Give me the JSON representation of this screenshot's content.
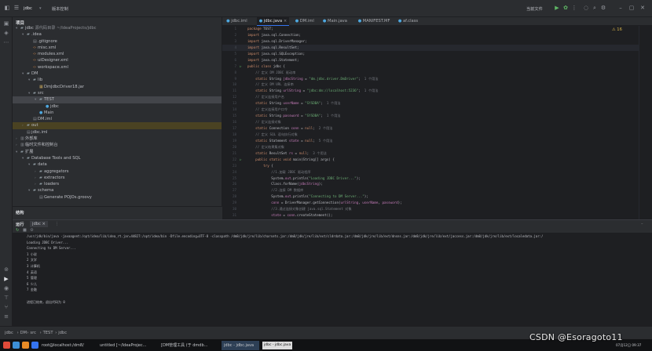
{
  "titlebar": {
    "project": "jdbc",
    "vcs": "版本控制",
    "run_config": "当前文件",
    "menu_icon": "hamburger-icon"
  },
  "project_panel": {
    "header": "项目",
    "tree": [
      {
        "depth": 0,
        "arrow": "▾",
        "icon": "folder",
        "label": "jdbc",
        "extra": " 源代码目录 ~/IdeaProjects/jdbc"
      },
      {
        "depth": 1,
        "arrow": "▾",
        "icon": "folder",
        "label": ".idea",
        "extra": ""
      },
      {
        "depth": 2,
        "arrow": "",
        "icon": "file",
        "label": ".gitignore",
        "extra": ""
      },
      {
        "depth": 2,
        "arrow": "",
        "icon": "xml",
        "label": "misc.xml",
        "extra": ""
      },
      {
        "depth": 2,
        "arrow": "",
        "icon": "xml",
        "label": "modules.xml",
        "extra": ""
      },
      {
        "depth": 2,
        "arrow": "",
        "icon": "xml",
        "label": "uiDesigner.xml",
        "extra": ""
      },
      {
        "depth": 2,
        "arrow": "",
        "icon": "xml",
        "label": "workspace.xml",
        "extra": ""
      },
      {
        "depth": 1,
        "arrow": "▾",
        "icon": "folder",
        "label": "DM",
        "extra": ""
      },
      {
        "depth": 2,
        "arrow": "▾",
        "icon": "folder",
        "label": "lib",
        "extra": ""
      },
      {
        "depth": 3,
        "arrow": "",
        "icon": "jar",
        "label": "DmJdbcDriver18.jar",
        "extra": ""
      },
      {
        "depth": 2,
        "arrow": "▾",
        "icon": "folder",
        "label": "src",
        "extra": ""
      },
      {
        "depth": 3,
        "arrow": "▾",
        "icon": "folder",
        "label": "TEST",
        "extra": "",
        "sel": true
      },
      {
        "depth": 4,
        "arrow": "",
        "icon": "java",
        "label": "jdbc",
        "extra": ""
      },
      {
        "depth": 3,
        "arrow": "",
        "icon": "java",
        "label": "Main",
        "extra": ""
      },
      {
        "depth": 2,
        "arrow": "",
        "icon": "file",
        "label": "DM.iml",
        "extra": ""
      },
      {
        "depth": 1,
        "arrow": "›",
        "icon": "folder",
        "label": "out",
        "extra": "",
        "hl": true
      },
      {
        "depth": 1,
        "arrow": "",
        "icon": "file",
        "label": "jdbc.iml",
        "extra": ""
      },
      {
        "depth": 0,
        "arrow": "›",
        "icon": "lib",
        "label": "外部库",
        "extra": ""
      },
      {
        "depth": 0,
        "arrow": "›",
        "icon": "lib",
        "label": "临时文件和控制台",
        "extra": ""
      },
      {
        "depth": 0,
        "arrow": "▾",
        "icon": "folder",
        "label": "扩展",
        "extra": ""
      },
      {
        "depth": 1,
        "arrow": "▾",
        "icon": "folder",
        "label": "Database Tools and SQL",
        "extra": ""
      },
      {
        "depth": 2,
        "arrow": "▾",
        "icon": "folder",
        "label": "data",
        "extra": ""
      },
      {
        "depth": 3,
        "arrow": "›",
        "icon": "folder",
        "label": "aggregators",
        "extra": ""
      },
      {
        "depth": 3,
        "arrow": "›",
        "icon": "folder",
        "label": "extractors",
        "extra": ""
      },
      {
        "depth": 3,
        "arrow": "›",
        "icon": "folder",
        "label": "loaders",
        "extra": ""
      },
      {
        "depth": 2,
        "arrow": "▾",
        "icon": "folder",
        "label": "schema",
        "extra": ""
      },
      {
        "depth": 3,
        "arrow": "",
        "icon": "file",
        "label": "Generate POJOs.groovy",
        "extra": ""
      }
    ],
    "structure_label": "结构"
  },
  "editor": {
    "tabs": [
      {
        "label": "jdbc.iml",
        "active": false
      },
      {
        "label": "jdbc.java",
        "active": true
      },
      {
        "label": "DM.iml",
        "active": false
      },
      {
        "label": "Main.java",
        "active": false
      },
      {
        "label": "MANIFEST.MF",
        "active": false
      },
      {
        "label": "af.class",
        "active": false
      }
    ],
    "inspection": "⚠ 16",
    "lines": [
      {
        "n": "1",
        "t": [
          [
            "kw",
            "package "
          ],
          [
            "ty",
            "TEST;"
          ]
        ]
      },
      {
        "n": "2",
        "t": [
          [
            "kw",
            "import "
          ],
          [
            "ty",
            "java.sql.Connection;"
          ]
        ]
      },
      {
        "n": "3",
        "t": [
          [
            "kw",
            "import "
          ],
          [
            "ty",
            "java.sql.DriverManager;"
          ]
        ]
      },
      {
        "n": "4",
        "t": [
          [
            "kw",
            "import "
          ],
          [
            "ty",
            "java.sql.ResultSet;"
          ]
        ],
        "cur": true
      },
      {
        "n": "5",
        "t": [
          [
            "kw",
            "import "
          ],
          [
            "ty",
            "java.sql.SQLException;"
          ]
        ]
      },
      {
        "n": "6",
        "t": [
          [
            "kw",
            "import "
          ],
          [
            "ty",
            "java.sql.Statement;"
          ]
        ]
      },
      {
        "n": "7",
        "run": true,
        "t": [
          [
            "kw",
            "public class "
          ],
          [
            "ty",
            "jdbc {"
          ]
        ]
      },
      {
        "n": "8",
        "t": [
          [
            "cm",
            "    // 定义 DM JDBC 驱动串"
          ]
        ]
      },
      {
        "n": "9",
        "t": [
          [
            "kw",
            "    static "
          ],
          [
            "ty",
            "String "
          ],
          [
            "fld",
            "jdbcString"
          ],
          [
            "ty",
            " = "
          ],
          [
            "str",
            "\"dm.jdbc.driver.DmDriver\""
          ],
          [
            "ty",
            ";"
          ],
          [
            "cm",
            "  1 个用法"
          ]
        ]
      },
      {
        "n": "10",
        "t": [
          [
            "cm",
            "    // 定义 DM URL 连接串"
          ]
        ]
      },
      {
        "n": "11",
        "t": [
          [
            "kw",
            "    static "
          ],
          [
            "ty",
            "String "
          ],
          [
            "fld",
            "urlString"
          ],
          [
            "ty",
            " = "
          ],
          [
            "str",
            "\"jdbc:dm://localhost:5236\""
          ],
          [
            "ty",
            ";"
          ],
          [
            "cm",
            "  1 个用法"
          ]
        ]
      },
      {
        "n": "12",
        "t": [
          [
            "cm",
            "    // 定义连接用户名"
          ]
        ]
      },
      {
        "n": "13",
        "t": [
          [
            "kw",
            "    static "
          ],
          [
            "ty",
            "String "
          ],
          [
            "fld",
            "userName"
          ],
          [
            "ty",
            " = "
          ],
          [
            "str",
            "\"SYSDBA\""
          ],
          [
            "ty",
            ";"
          ],
          [
            "cm",
            "  1 个用法"
          ]
        ]
      },
      {
        "n": "14",
        "t": [
          [
            "cm",
            "    // 定义连接用户口令"
          ]
        ]
      },
      {
        "n": "15",
        "t": [
          [
            "kw",
            "    static "
          ],
          [
            "ty",
            "String "
          ],
          [
            "fld",
            "password"
          ],
          [
            "ty",
            " = "
          ],
          [
            "str",
            "\"SYSDBA\""
          ],
          [
            "ty",
            ";"
          ],
          [
            "cm",
            "  1 个用法"
          ]
        ]
      },
      {
        "n": "16",
        "t": [
          [
            "cm",
            "    // 定义连接对象"
          ]
        ]
      },
      {
        "n": "17",
        "t": [
          [
            "kw",
            "    static "
          ],
          [
            "ty",
            "Connection "
          ],
          [
            "fld",
            "conn"
          ],
          [
            "ty",
            " = "
          ],
          [
            "kw",
            "null"
          ],
          [
            "ty",
            ";"
          ],
          [
            "cm",
            "  2 个用法"
          ]
        ]
      },
      {
        "n": "18",
        "t": [
          [
            "cm",
            "    // 定义 SQL 语句执行对象"
          ]
        ]
      },
      {
        "n": "19",
        "t": [
          [
            "kw",
            "    static "
          ],
          [
            "ty",
            "Statement "
          ],
          [
            "fld",
            "state"
          ],
          [
            "ty",
            " = "
          ],
          [
            "kw",
            "null"
          ],
          [
            "ty",
            ";"
          ],
          [
            "cm",
            "  5 个用法"
          ]
        ]
      },
      {
        "n": "20",
        "t": [
          [
            "cm",
            "    // 定义结果集对象"
          ]
        ]
      },
      {
        "n": "21",
        "t": [
          [
            "kw",
            "    static "
          ],
          [
            "ty",
            "ResultSet "
          ],
          [
            "fld",
            "rs"
          ],
          [
            "ty",
            " = "
          ],
          [
            "kw",
            "null"
          ],
          [
            "ty",
            ";"
          ],
          [
            "cm",
            "  3 个用法"
          ]
        ]
      },
      {
        "n": "22",
        "run": true,
        "t": [
          [
            "kw",
            "    public static void "
          ],
          [
            "ty",
            "main(String[] args) {"
          ]
        ]
      },
      {
        "n": "23",
        "t": [
          [
            "kw",
            "        try "
          ],
          [
            "ty",
            "{"
          ]
        ]
      },
      {
        "n": "24",
        "t": [
          [
            "cm",
            "            //1.加载 JDBC 驱动程序"
          ]
        ]
      },
      {
        "n": "25",
        "t": [
          [
            "ty",
            "            System."
          ],
          [
            "fld",
            "out"
          ],
          [
            "ty",
            ".println("
          ],
          [
            "str",
            "\"Loading JDBC Driver...\""
          ],
          [
            "ty",
            ");"
          ]
        ]
      },
      {
        "n": "26",
        "t": [
          [
            "ty",
            "            Class.forName("
          ],
          [
            "fld",
            "jdbcString"
          ],
          [
            "ty",
            ");"
          ]
        ]
      },
      {
        "n": "27",
        "t": [
          [
            "cm",
            "            //2.连接 DM 数据库"
          ]
        ]
      },
      {
        "n": "28",
        "t": [
          [
            "ty",
            "            System."
          ],
          [
            "fld",
            "out"
          ],
          [
            "ty",
            ".println("
          ],
          [
            "str",
            "\"Connecting to DM Server...\""
          ],
          [
            "ty",
            ");"
          ]
        ]
      },
      {
        "n": "29",
        "t": [
          [
            "fld",
            "            conn"
          ],
          [
            "ty",
            " = DriverManager.getConnection("
          ],
          [
            "fld",
            "urlString"
          ],
          [
            "ty",
            ", "
          ],
          [
            "fld",
            "userName"
          ],
          [
            "ty",
            ", "
          ],
          [
            "fld",
            "password"
          ],
          [
            "ty",
            ");"
          ]
        ]
      },
      {
        "n": "30",
        "t": [
          [
            "cm",
            "            //3.通过连接对象创建 java.sql.Statement 对象"
          ]
        ]
      },
      {
        "n": "31",
        "t": [
          [
            "fld",
            "            state"
          ],
          [
            "ty",
            " = "
          ],
          [
            "fld",
            "conn"
          ],
          [
            "ty",
            ".createStatement();"
          ]
        ]
      }
    ]
  },
  "run_panel": {
    "title": "运行",
    "tab": "jdbc",
    "console": [
      "/usr/jdk/bin/java -javaagent:/opt/idea/lib/idea_rt.jar=44827:/opt/idea/bin -Dfile.encoding=UTF-8 -classpath /dm8/jdk/jre/lib/charsets.jar:/dm8/jdk/jre/lib/ext/cldrdata.jar:/dm8/jdk/jre/lib/ext/dnsns.jar:/dm8/jdk/jre/lib/ext/jaccess.jar:/dm8/jdk/jre/lib/ext/localedata.jar:/",
      "Loading JDBC Driver...",
      "Connecting to DM Server...",
      "1  小说",
      "2  文学",
      "3  计算机",
      "4  英语",
      "5  管理",
      "6  少儿",
      "7  金融",
      "",
      "进程已结束，退出代码为 0"
    ]
  },
  "statusbar": {
    "crumbs": [
      "jdbc",
      "DM",
      "src",
      "TEST",
      "jdbc"
    ]
  },
  "taskbar": {
    "items": [
      {
        "label": "root@localhost:/dm8/",
        "active": false
      },
      {
        "label": "untitled [~/IdeaProjec...",
        "active": false
      },
      {
        "label": "[DM管理工具 (于 dmdb...",
        "active": false
      },
      {
        "label": "jdbc - jdbc.java",
        "active": true
      }
    ],
    "tooltip": "jdbc - jdbc.java",
    "clock_date": "07月12日 09:37"
  },
  "watermark": "CSDN @Esoragoto11",
  "colors": {
    "bg": "#1e1f22",
    "panel": "#2b2d30",
    "accent": "#3574f0",
    "keyword": "#cf8e6d",
    "string": "#6aab73",
    "field": "#c77dbb"
  }
}
